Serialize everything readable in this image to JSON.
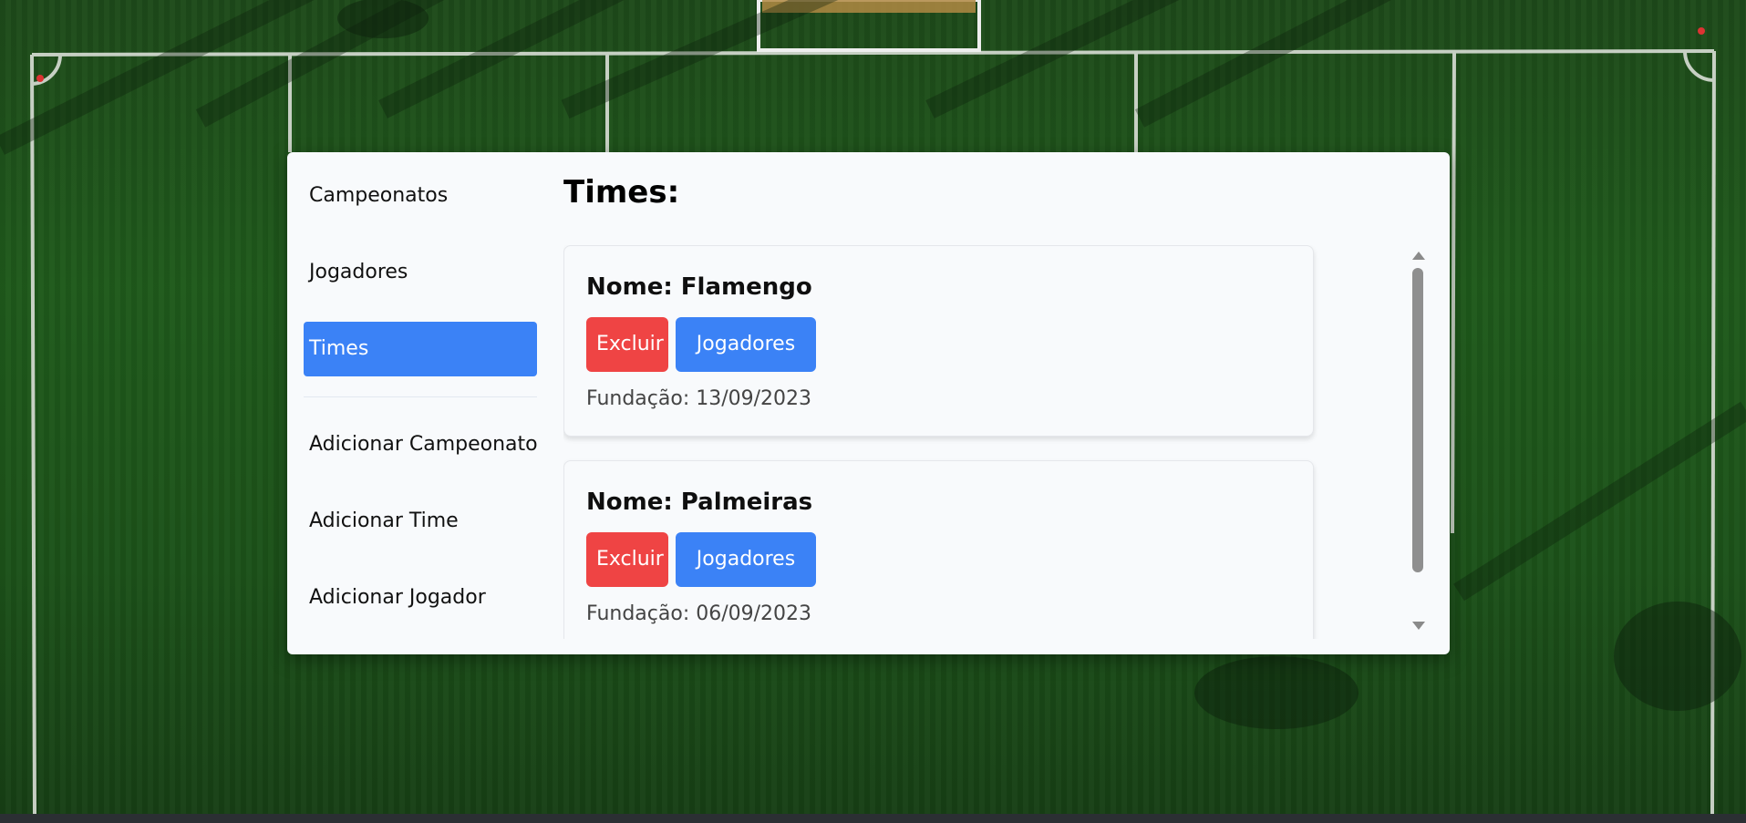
{
  "sidebar": {
    "items": [
      {
        "label": "Campeonatos",
        "active": false
      },
      {
        "label": "Jogadores",
        "active": false
      },
      {
        "label": "Times",
        "active": true
      },
      {
        "label": "Adicionar Campeonato",
        "active": false
      },
      {
        "label": "Adicionar Time",
        "active": false
      },
      {
        "label": "Adicionar Jogador",
        "active": false
      }
    ]
  },
  "main": {
    "title": "Times:",
    "teams": [
      {
        "name": "Nome: Flamengo",
        "delete_label": "Excluir",
        "players_label": "Jogadores",
        "founded": "Fundação: 13/09/2023"
      },
      {
        "name": "Nome: Palmeiras",
        "delete_label": "Excluir",
        "players_label": "Jogadores",
        "founded": "Fundação: 06/09/2023"
      }
    ]
  },
  "colors": {
    "primary": "#3b82f6",
    "danger": "#ef4444",
    "panel_bg": "#f8fafc"
  },
  "icons": {
    "scroll_up": "scroll-up-arrow-icon",
    "scroll_down": "scroll-down-arrow-icon"
  }
}
